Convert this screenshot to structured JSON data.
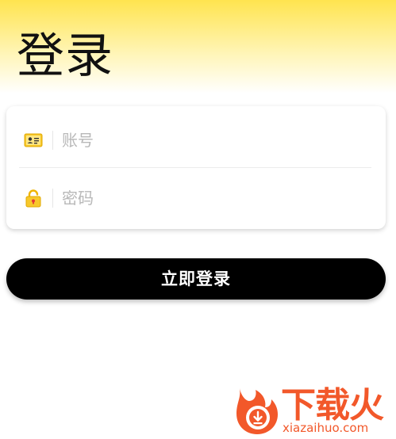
{
  "page": {
    "title": "登录"
  },
  "form": {
    "account": {
      "placeholder": "账号",
      "value": "",
      "icon": "id-card-icon"
    },
    "password": {
      "placeholder": "密码",
      "value": "",
      "icon": "lock-icon"
    }
  },
  "actions": {
    "login_label": "立即登录"
  },
  "watermark": {
    "brand": "下载火",
    "domain": "xiazaihuo.com"
  },
  "colors": {
    "header_gradient_top": "#ffe44f",
    "button_bg": "#000000",
    "button_text": "#ffffff",
    "icon_yellow": "#f7c82b",
    "watermark": "#f2582a"
  }
}
